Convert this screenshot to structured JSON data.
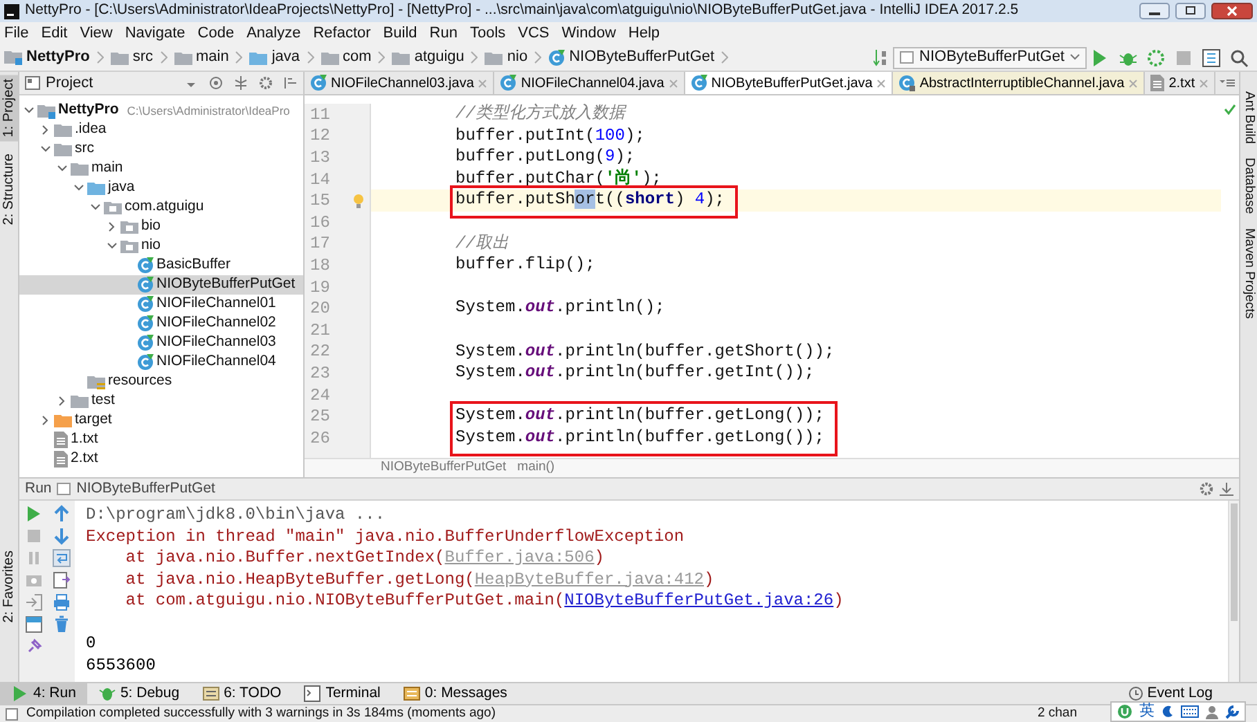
{
  "window": {
    "title": "NettyPro - [C:\\Users\\Administrator\\IdeaProjects\\NettyPro] - [NettyPro] - ...\\src\\main\\java\\com\\atguigu\\nio\\NIOByteBufferPutGet.java - IntelliJ IDEA 2017.2.5"
  },
  "menu": [
    "File",
    "Edit",
    "View",
    "Navigate",
    "Code",
    "Analyze",
    "Refactor",
    "Build",
    "Run",
    "Tools",
    "VCS",
    "Window",
    "Help"
  ],
  "breadcrumbs": [
    {
      "label": "NettyPro",
      "kind": "project"
    },
    {
      "label": "src",
      "kind": "folder"
    },
    {
      "label": "main",
      "kind": "folder"
    },
    {
      "label": "java",
      "kind": "source"
    },
    {
      "label": "com",
      "kind": "folder"
    },
    {
      "label": "atguigu",
      "kind": "folder"
    },
    {
      "label": "nio",
      "kind": "folder"
    },
    {
      "label": "NIOByteBufferPutGet",
      "kind": "class"
    }
  ],
  "run_config": "NIOByteBufferPutGet",
  "left_stripe": [
    {
      "label": "1: Project",
      "selected": true
    },
    {
      "label": "2: Structure",
      "selected": false
    },
    {
      "label": "2: Favorites",
      "selected": false
    }
  ],
  "project_panel": {
    "title": "Project",
    "tree": [
      {
        "label": "NettyPro",
        "path": "C:\\Users\\Administrator\\IdeaPro",
        "kind": "project",
        "expanded": true,
        "selected": false,
        "children": [
          {
            "label": ".idea",
            "kind": "folder",
            "expanded": false,
            "selected": false
          },
          {
            "label": "src",
            "kind": "folder",
            "expanded": true,
            "selected": false,
            "children": [
              {
                "label": "main",
                "kind": "folder",
                "expanded": true,
                "selected": false,
                "children": [
                  {
                    "label": "java",
                    "kind": "source",
                    "expanded": true,
                    "selected": false,
                    "children": [
                      {
                        "label": "com.atguigu",
                        "kind": "package",
                        "expanded": true,
                        "selected": false,
                        "children": [
                          {
                            "label": "bio",
                            "kind": "package",
                            "expanded": false,
                            "selected": false
                          },
                          {
                            "label": "nio",
                            "kind": "package",
                            "expanded": true,
                            "selected": false,
                            "children": [
                              {
                                "label": "BasicBuffer",
                                "kind": "class",
                                "selected": false
                              },
                              {
                                "label": "NIOByteBufferPutGet",
                                "kind": "class",
                                "selected": true
                              },
                              {
                                "label": "NIOFileChannel01",
                                "kind": "class",
                                "selected": false
                              },
                              {
                                "label": "NIOFileChannel02",
                                "kind": "class",
                                "selected": false
                              },
                              {
                                "label": "NIOFileChannel03",
                                "kind": "class",
                                "selected": false
                              },
                              {
                                "label": "NIOFileChannel04",
                                "kind": "class",
                                "selected": false
                              }
                            ]
                          }
                        ]
                      }
                    ]
                  },
                  {
                    "label": "resources",
                    "kind": "resources",
                    "selected": false
                  }
                ]
              },
              {
                "label": "test",
                "kind": "folder",
                "expanded": false,
                "selected": false
              }
            ]
          },
          {
            "label": "target",
            "kind": "target",
            "expanded": false,
            "selected": false
          },
          {
            "label": "1.txt",
            "kind": "file",
            "selected": false
          },
          {
            "label": "2.txt",
            "kind": "file",
            "selected": false
          }
        ]
      }
    ]
  },
  "editor": {
    "tabs": [
      {
        "label": "NIOFileChannel03.java",
        "kind": "class",
        "selected": false
      },
      {
        "label": "NIOFileChannel04.java",
        "kind": "class",
        "selected": false
      },
      {
        "label": "NIOByteBufferPutGet.java",
        "kind": "class",
        "selected": true
      },
      {
        "label": "AbstractInterruptibleChannel.java",
        "kind": "library",
        "selected": false
      },
      {
        "label": "2.txt",
        "kind": "text",
        "selected": false
      }
    ],
    "lines": [
      {
        "number": "11",
        "current": false,
        "boxed": false,
        "segments": [
          {
            "kind": "comment",
            "text": "//类型化方式放入数据"
          }
        ]
      },
      {
        "number": "12",
        "current": false,
        "boxed": false,
        "segments": [
          {
            "kind": "plain",
            "text": "buffer.putInt("
          },
          {
            "kind": "number",
            "text": "100"
          },
          {
            "kind": "plain",
            "text": ");"
          }
        ]
      },
      {
        "number": "13",
        "current": false,
        "boxed": false,
        "segments": [
          {
            "kind": "plain",
            "text": "buffer.putLong("
          },
          {
            "kind": "number",
            "text": "9"
          },
          {
            "kind": "plain",
            "text": ");"
          }
        ]
      },
      {
        "number": "14",
        "current": false,
        "boxed": false,
        "segments": [
          {
            "kind": "plain",
            "text": "buffer.putChar("
          },
          {
            "kind": "string",
            "text": "'尚'"
          },
          {
            "kind": "plain",
            "text": ");"
          }
        ]
      },
      {
        "number": "15",
        "current": true,
        "intention": true,
        "boxed": true,
        "segments": [
          {
            "kind": "plain",
            "text": "buffer.putSh"
          },
          {
            "kind": "selection",
            "text": "or"
          },
          {
            "kind": "plain",
            "text": "t(("
          },
          {
            "kind": "keyword",
            "text": "short"
          },
          {
            "kind": "plain",
            "text": ") "
          },
          {
            "kind": "number",
            "text": "4"
          },
          {
            "kind": "plain",
            "text": ");"
          }
        ]
      },
      {
        "number": "16",
        "current": false,
        "boxed": false
      },
      {
        "number": "17",
        "current": false,
        "boxed": false,
        "segments": [
          {
            "kind": "comment",
            "text": "//取出"
          }
        ]
      },
      {
        "number": "18",
        "current": false,
        "boxed": false,
        "segments": [
          {
            "kind": "plain",
            "text": "buffer.flip();"
          }
        ]
      },
      {
        "number": "19",
        "current": false,
        "boxed": false
      },
      {
        "number": "20",
        "current": false,
        "boxed": false,
        "segments": [
          {
            "kind": "plain",
            "text": "System."
          },
          {
            "kind": "field",
            "text": "out"
          },
          {
            "kind": "plain",
            "text": ".println();"
          }
        ]
      },
      {
        "number": "21",
        "current": false,
        "boxed": false
      },
      {
        "number": "22",
        "current": false,
        "boxed": false,
        "segments": [
          {
            "kind": "plain",
            "text": "System."
          },
          {
            "kind": "field",
            "text": "out"
          },
          {
            "kind": "plain",
            "text": ".println(buffer.getShort());"
          }
        ]
      },
      {
        "number": "23",
        "current": false,
        "boxed": false,
        "segments": [
          {
            "kind": "plain",
            "text": "System."
          },
          {
            "kind": "field",
            "text": "out"
          },
          {
            "kind": "plain",
            "text": ".println(buffer.getInt());"
          }
        ]
      },
      {
        "number": "24",
        "current": false,
        "boxed": false
      },
      {
        "number": "25",
        "current": false,
        "boxed": true,
        "segments": [
          {
            "kind": "plain",
            "text": "System."
          },
          {
            "kind": "field",
            "text": "out"
          },
          {
            "kind": "plain",
            "text": ".println(buffer.getLong());"
          }
        ]
      },
      {
        "number": "26",
        "current": false,
        "boxed": true,
        "segments": [
          {
            "kind": "plain",
            "text": "System."
          },
          {
            "kind": "field",
            "text": "out"
          },
          {
            "kind": "plain",
            "text": ".println(buffer.getLong());"
          }
        ]
      }
    ],
    "breadcrumb": [
      "NIOByteBufferPutGet",
      "main()"
    ]
  },
  "right_stripe": [
    "Ant Build",
    "Database",
    "Maven Projects"
  ],
  "run_panel": {
    "title": "Run",
    "config": "NIOByteBufferPutGet",
    "console": [
      {
        "kind": "text",
        "segments": [
          {
            "kind": "command",
            "text": "D:\\program\\jdk8.0\\bin\\java ..."
          }
        ]
      },
      {
        "kind": "text",
        "segments": [
          {
            "kind": "error",
            "text": "Exception in thread \"main\" java.nio.BufferUnderflowException"
          }
        ]
      },
      {
        "kind": "text",
        "segments": [
          {
            "kind": "error",
            "text": "    at java.nio.Buffer.nextGetIndex("
          },
          {
            "kind": "library_link",
            "text": "Buffer.java:506"
          },
          {
            "kind": "error",
            "text": ")"
          }
        ]
      },
      {
        "kind": "text",
        "segments": [
          {
            "kind": "error",
            "text": "    at java.nio.HeapByteBuffer.getLong("
          },
          {
            "kind": "library_link",
            "text": "HeapByteBuffer.java:412"
          },
          {
            "kind": "error",
            "text": ")"
          }
        ]
      },
      {
        "kind": "text",
        "segments": [
          {
            "kind": "error",
            "text": "    at com.atguigu.nio.NIOByteBufferPutGet.main("
          },
          {
            "kind": "link",
            "text": "NIOByteBufferPutGet.java:26"
          },
          {
            "kind": "error",
            "text": ")"
          }
        ]
      },
      {
        "kind": "blank"
      },
      {
        "kind": "text",
        "segments": [
          {
            "kind": "plain",
            "text": "0"
          }
        ]
      },
      {
        "kind": "text",
        "segments": [
          {
            "kind": "plain",
            "text": "6553600"
          }
        ]
      }
    ]
  },
  "tool_tabs": [
    {
      "label": "4: Run",
      "kind": "run",
      "selected": true
    },
    {
      "label": "5: Debug",
      "kind": "debug",
      "selected": false
    },
    {
      "label": "6: TODO",
      "kind": "todo",
      "selected": false
    },
    {
      "label": "Terminal",
      "kind": "terminal",
      "selected": false
    },
    {
      "label": "0: Messages",
      "kind": "messages",
      "selected": false
    }
  ],
  "event_log": "Event Log",
  "status_bar": {
    "message": "Compilation completed successfully with 3 warnings in 3s 184ms (moments ago)",
    "changes": "2 chan"
  },
  "ime_bar": {
    "label": "英"
  }
}
